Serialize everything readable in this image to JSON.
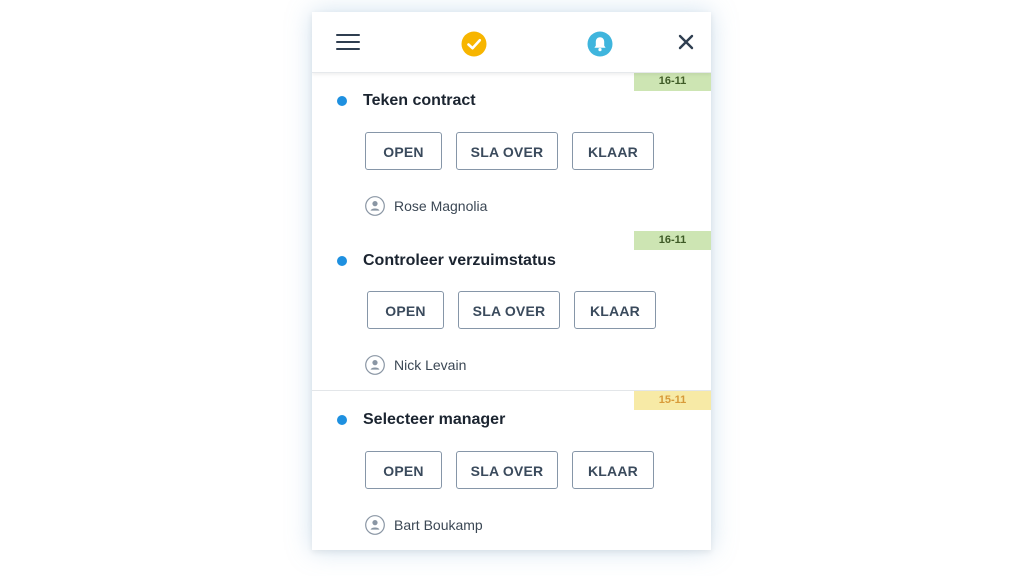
{
  "header": {
    "menu_icon": "hamburger-menu-icon",
    "check_icon": "check-circle-icon",
    "bell_icon": "bell-icon",
    "close_icon": "close-icon",
    "colors": {
      "check": "#f7b500",
      "bell": "#3fb5dd",
      "dark": "#2f3e50"
    }
  },
  "tasks": [
    {
      "title": "Teken contract",
      "date": "16-11",
      "date_status": "green",
      "buttons": [
        "OPEN",
        "SLA OVER",
        "KLAAR"
      ],
      "assignee": "Rose Magnolia"
    },
    {
      "title": "Controleer verzuimstatus",
      "date": "16-11",
      "date_status": "green",
      "buttons": [
        "OPEN",
        "SLA OVER",
        "KLAAR"
      ],
      "assignee": "Nick Levain"
    },
    {
      "title": "Selecteer manager",
      "date": "15-11",
      "date_status": "yellow",
      "buttons": [
        "OPEN",
        "SLA OVER",
        "KLAAR"
      ],
      "assignee": "Bart Boukamp"
    }
  ],
  "colors": {
    "dot": "#1e90e0",
    "badge_green": "#cde5b3",
    "badge_yellow": "#f7eaa6",
    "button_border": "#8696a8"
  }
}
